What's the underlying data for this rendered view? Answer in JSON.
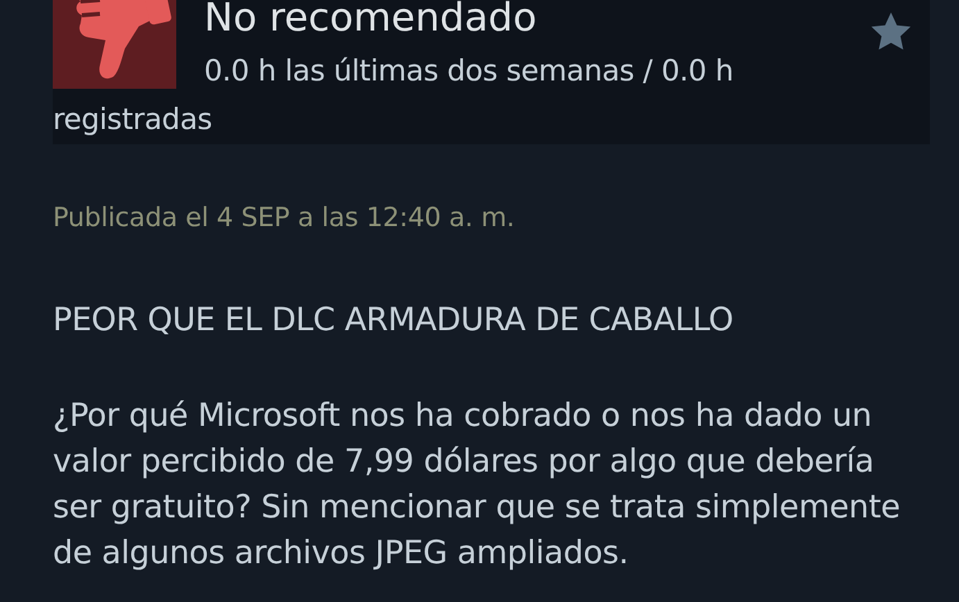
{
  "review": {
    "verdict": "No recomendado",
    "recommended": false,
    "hours": "0.0 h las últimas dos semanas / 0.0 h registradas",
    "posted": "Publicada el 4 SEP a las 12:40 a. m.",
    "title": "PEOR QUE EL DLC ARMADURA DE CABALLO",
    "body": "¿Por qué Microsoft nos ha cobrado o nos ha dado un valor percibido de 7,99 dólares por algo que debería ser gratuito? Sin mencionar que se trata simplemente de algunos archivos JPEG ampliados."
  }
}
